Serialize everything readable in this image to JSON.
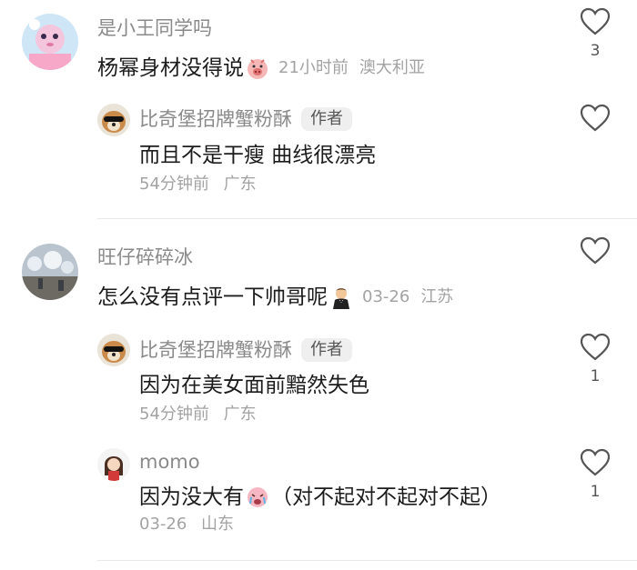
{
  "comments": [
    {
      "username": "是小王同学吗",
      "text": "杨幂身材没得说",
      "emoji": "pig-face-emoji",
      "time": "21小时前",
      "location": "澳大利亚",
      "likes": "3",
      "reply": {
        "username": "比奇堡招牌蟹粉酥",
        "badge": "作者",
        "text": "而且不是干瘦 曲线很漂亮",
        "time": "54分钟前",
        "location": "广东",
        "likes": ""
      }
    },
    {
      "username": "旺仔碎碎冰",
      "text": "怎么没有点评一下帅哥呢",
      "emoji": "man-in-tuxedo-emoji",
      "time": "03-26",
      "location": "江苏",
      "likes": "",
      "replies": [
        {
          "username": "比奇堡招牌蟹粉酥",
          "badge": "作者",
          "text": "因为在美女面前黯然失色",
          "time": "54分钟前",
          "location": "广东",
          "likes": "1"
        },
        {
          "username": "momo",
          "text_before": "因为没大有",
          "emoji": "crying-face-emoji",
          "text_after": "（对不起对不起对不起）",
          "time": "03-26",
          "location": "山东",
          "likes": "1"
        }
      ]
    }
  ],
  "colors": {
    "username": "#8a8a8a",
    "meta": "#a3a3a3",
    "text": "#1c1c1c",
    "badge_bg": "#efefef"
  }
}
